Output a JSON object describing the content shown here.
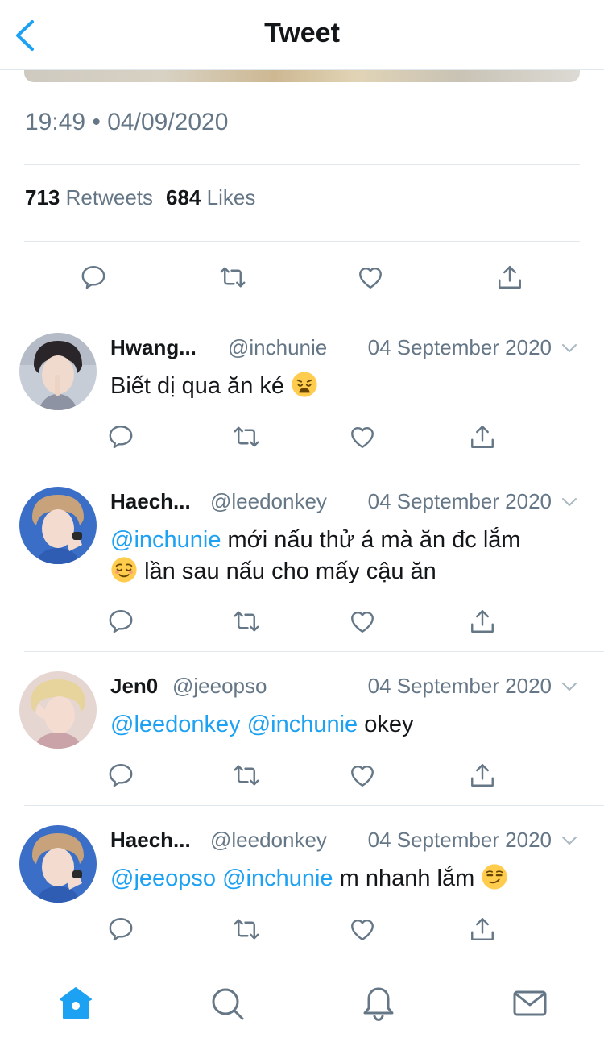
{
  "header": {
    "title": "Tweet"
  },
  "tweet": {
    "timestamp": "19:49 • 04/09/2020",
    "retweets_count": "713",
    "retweets_label": "Retweets",
    "likes_count": "684",
    "likes_label": "Likes"
  },
  "replies": [
    {
      "name": "Hwang...",
      "handle": "@inchunie",
      "date": "04 September 2020",
      "text": "Biết dị qua ăn ké",
      "emoji": "weary-face"
    },
    {
      "name": "Haech...",
      "handle": "@leedonkey",
      "date": "04 September 2020",
      "mention": "@inchunie",
      "text_line1": " mới nấu thử á mà ăn đc lắm",
      "emoji": "relieved-face",
      "text_line2": "lần sau nấu cho mấy cậu ăn"
    },
    {
      "name": "Jen0",
      "handle": "@jeeopso",
      "date": "04 September 2020",
      "mention1": "@leedonkey",
      "mention2": "@inchunie",
      "text": " okey"
    },
    {
      "name": "Haech...",
      "handle": "@leedonkey",
      "date": "04 September 2020",
      "mention1": "@jeeopso",
      "mention2": "@inchunie",
      "text": " m nhanh lắm",
      "emoji": "smirking-face"
    }
  ],
  "colors": {
    "accent": "#1da1f2",
    "secondary_text": "#657786",
    "divider": "#e1e8ed"
  },
  "bottom_nav": [
    "home-icon",
    "search-icon",
    "notifications-icon",
    "messages-icon"
  ]
}
